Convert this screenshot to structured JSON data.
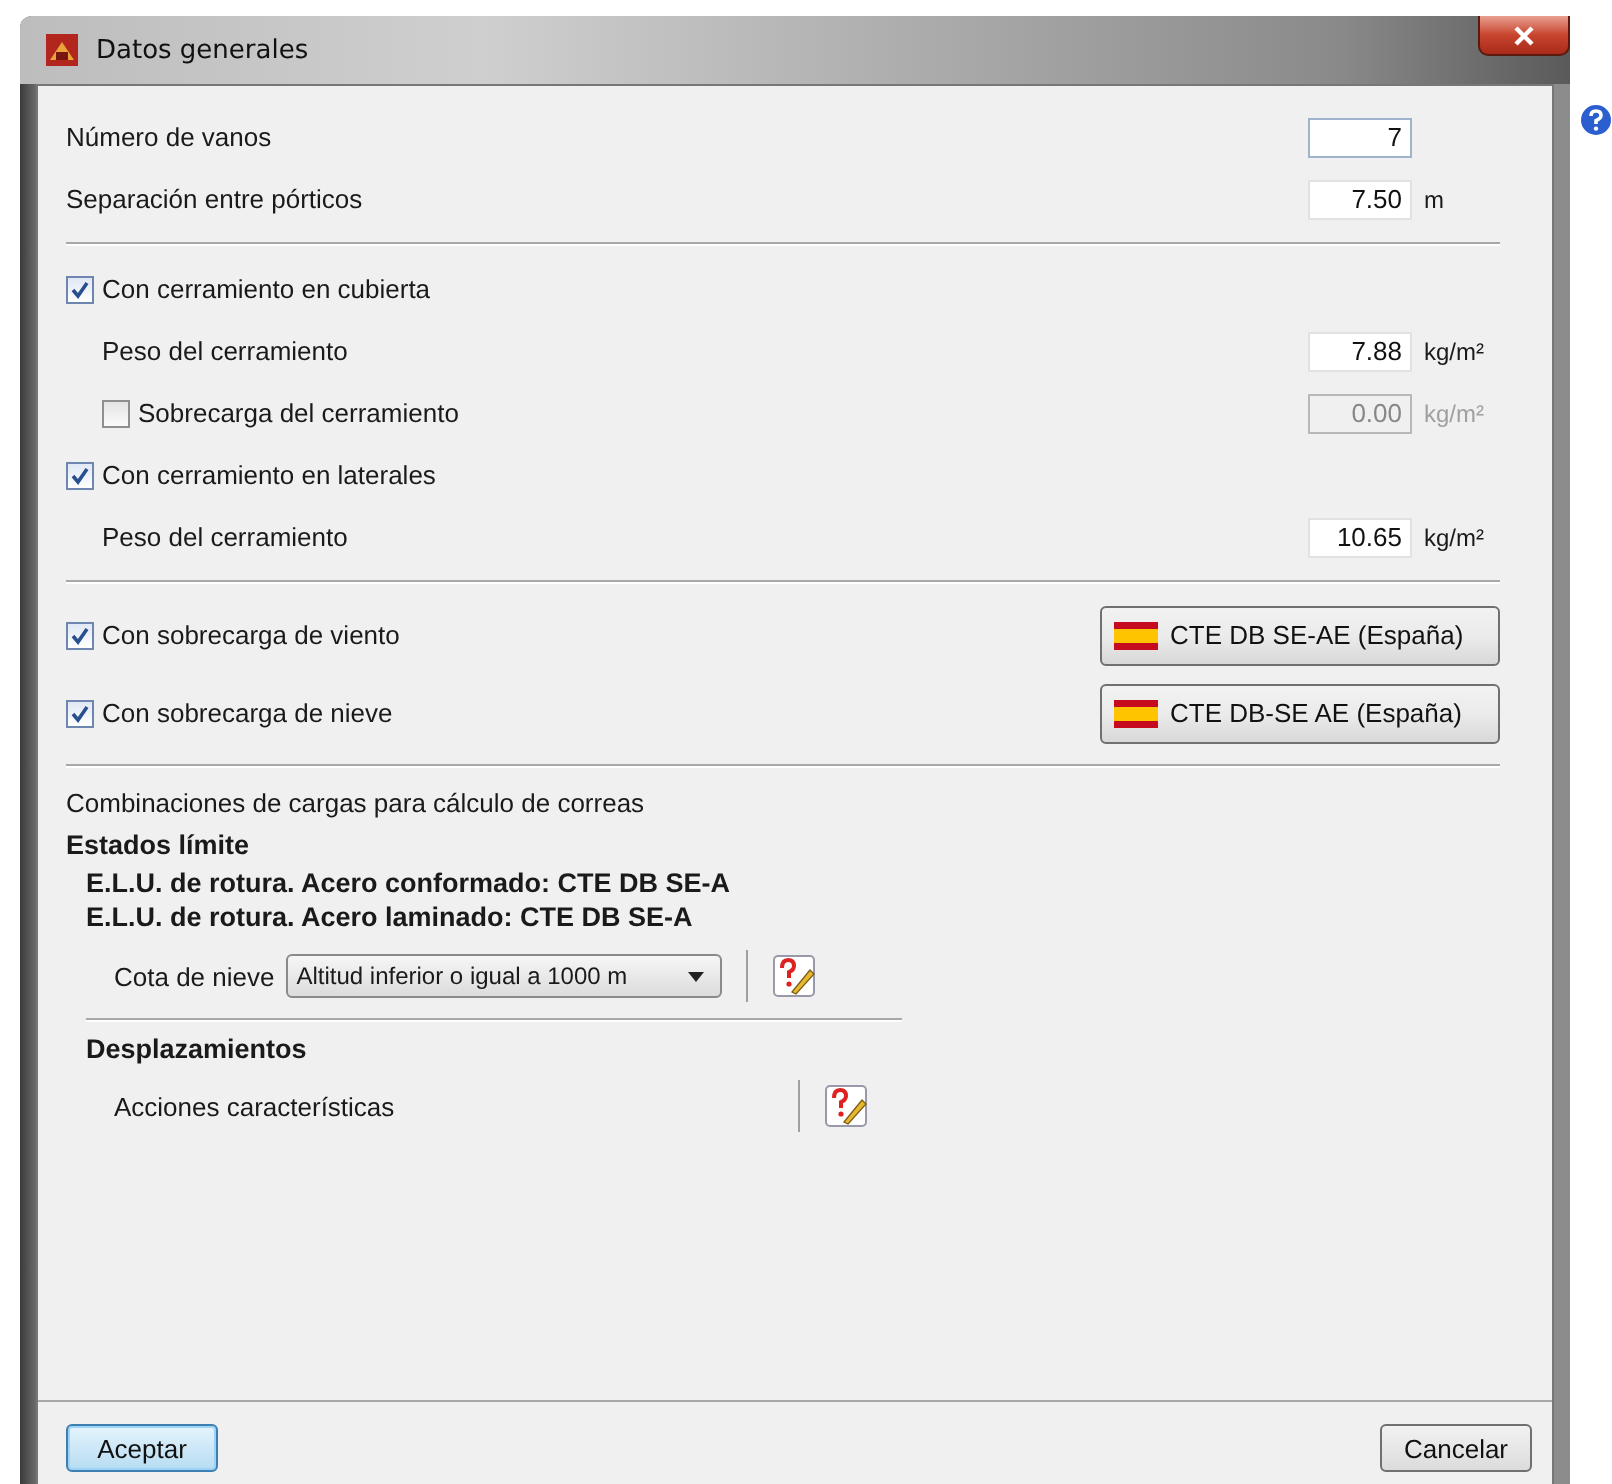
{
  "window": {
    "title": "Datos generales"
  },
  "general": [
    {
      "label": "Número de vanos",
      "value": "7",
      "focused": true
    },
    {
      "label": "Separación entre pórticos",
      "value": "7.50",
      "unit": "m",
      "focused": false
    }
  ],
  "enclosures": [
    {
      "label": "Con cerramiento en cubierta",
      "checked": true,
      "children": [
        {
          "kind": "field",
          "label": "Peso del cerramiento",
          "value": "7.88",
          "unit": "kg/m²",
          "disabled": false
        },
        {
          "kind": "check-field",
          "label": "Sobrecarga del cerramiento",
          "checked": false,
          "value": "0.00",
          "unit": "kg/m²",
          "disabled": true
        }
      ]
    },
    {
      "label": "Con cerramiento en laterales",
      "checked": true,
      "children": [
        {
          "kind": "field",
          "label": "Peso del cerramiento",
          "value": "10.65",
          "unit": "kg/m²",
          "disabled": false
        }
      ]
    }
  ],
  "loads": [
    {
      "label": "Con sobrecarga de viento",
      "checked": true,
      "button": "CTE DB SE-AE (España)"
    },
    {
      "label": "Con sobrecarga de nieve",
      "checked": true,
      "button": "CTE DB-SE AE (España)"
    }
  ],
  "combinations": {
    "title": "Combinaciones de cargas para cálculo de correas",
    "heading": "Estados límite",
    "lines": [
      "E.L.U. de rotura. Acero conformado: CTE DB SE-A",
      "E.L.U. de rotura. Acero laminado: CTE DB SE-A"
    ],
    "select": {
      "label": "Cota de nieve",
      "value": "Altitud inferior o igual a 1000 m"
    },
    "displacements": {
      "heading": "Desplazamientos",
      "item": "Acciones características"
    }
  },
  "buttons": [
    {
      "label": "Aceptar",
      "default": true
    },
    {
      "label": "Cancelar",
      "default": false
    }
  ]
}
